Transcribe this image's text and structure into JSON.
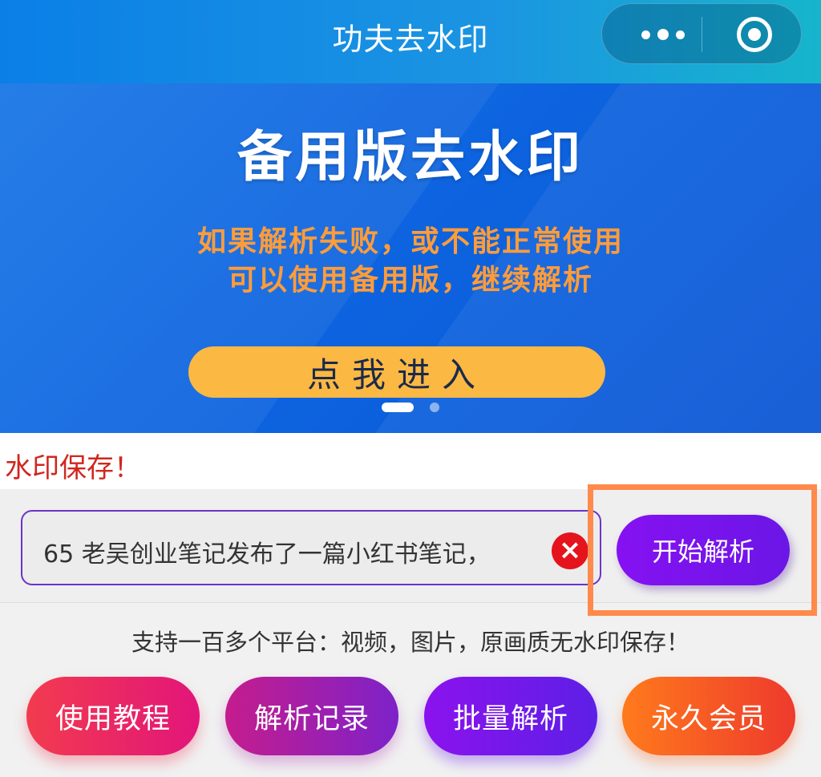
{
  "navbar": {
    "title": "功夫去水印"
  },
  "banner": {
    "title": "备用版去水印",
    "subtitle_line1": "如果解析失败，或不能正常使用",
    "subtitle_line2": "可以使用备用版，继续解析",
    "enter_label": "点我进入",
    "carousel": {
      "total": 2,
      "active": 1
    }
  },
  "marquee": {
    "text": "水印保存！"
  },
  "parser": {
    "input_value": "65 老吴创业笔记发布了一篇小红书笔记，",
    "parse_label": "开始解析",
    "highlight_color": "#ff8a4c"
  },
  "support_text": "支持一百多个平台：视频，图片，原画质无水印保存！",
  "actions": [
    {
      "label": "使用教程"
    },
    {
      "label": "解析记录"
    },
    {
      "label": "批量解析"
    },
    {
      "label": "永久会员"
    }
  ]
}
